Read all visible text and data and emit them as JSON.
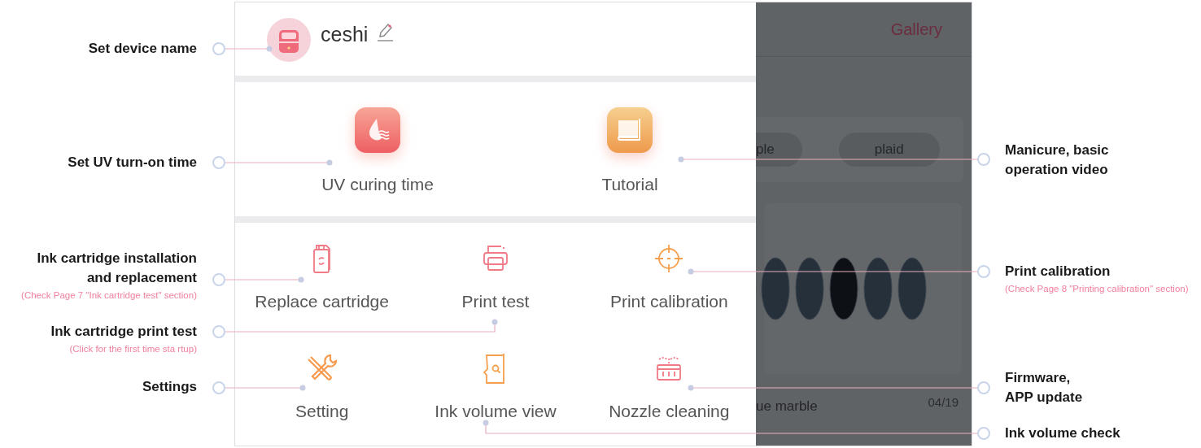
{
  "drawer": {
    "device_name": "ceshi",
    "features": [
      {
        "label": "UV curing time",
        "kind": "drop"
      },
      {
        "label": "Tutorial",
        "kind": "book"
      }
    ],
    "tools": [
      {
        "label": "Replace cartridge",
        "kind": "cartridge"
      },
      {
        "label": "Print test",
        "kind": "printer"
      },
      {
        "label": "Print calibration",
        "kind": "crosshair"
      },
      {
        "label": "Setting",
        "kind": "tools"
      },
      {
        "label": "Ink volume view",
        "kind": "ink"
      },
      {
        "label": "Nozzle cleaning",
        "kind": "nozzle"
      }
    ]
  },
  "background": {
    "title": "Gallery",
    "chips": [
      "ple",
      "plaid"
    ],
    "design_name": "ue marble",
    "date": "04/19"
  },
  "annotations": [
    {
      "title": "Set device name"
    },
    {
      "title": "Set UV turn-on time"
    },
    {
      "title": "Ink cartridge installation\nand replacement",
      "note": "(Check Page 7 \"Ink cartridge test\" section)"
    },
    {
      "title": "Ink cartridge print test",
      "note": "(Click for the first time sta rtup)"
    },
    {
      "title": "Settings"
    },
    {
      "title": "Manicure, basic\noperation video"
    },
    {
      "title": "Print calibration",
      "note": "(Check Page 8 \"Printing calibration\" section)"
    },
    {
      "title": "Firmware,\nAPP update"
    },
    {
      "title": "Ink volume check"
    }
  ]
}
